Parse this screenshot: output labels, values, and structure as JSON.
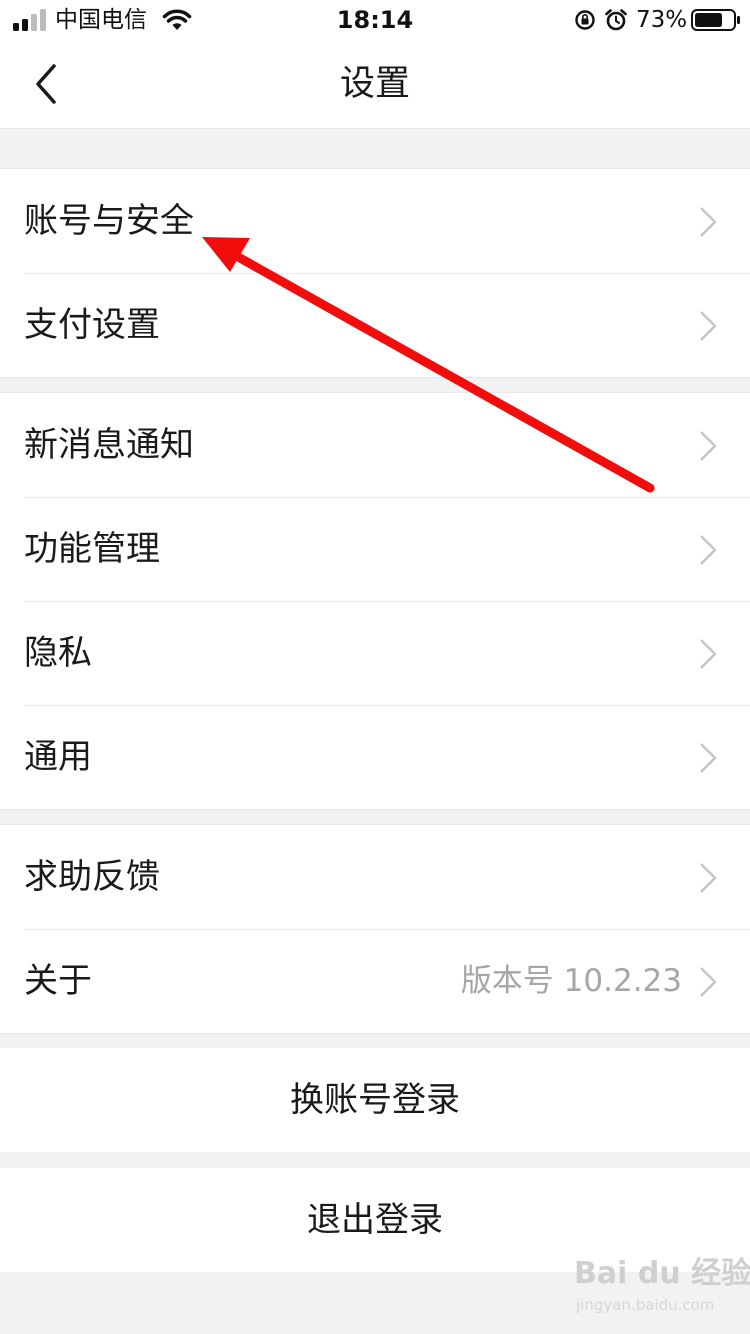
{
  "status_bar": {
    "carrier": "中国电信",
    "time": "18:14",
    "battery_percent": "73%",
    "battery_level": 0.73,
    "icons": [
      "signal-icon",
      "wifi-icon",
      "rotation-lock-icon",
      "alarm-icon",
      "battery-icon"
    ]
  },
  "nav": {
    "title": "设置",
    "back_icon": "chevron-left-icon"
  },
  "groups": [
    {
      "items": [
        {
          "label": "账号与安全"
        },
        {
          "label": "支付设置"
        }
      ]
    },
    {
      "items": [
        {
          "label": "新消息通知"
        },
        {
          "label": "功能管理"
        },
        {
          "label": "隐私"
        },
        {
          "label": "通用"
        }
      ]
    },
    {
      "items": [
        {
          "label": "求助反馈"
        },
        {
          "label": "关于",
          "value": "版本号 10.2.23"
        }
      ]
    }
  ],
  "actions": {
    "switch_account": "换账号登录",
    "logout": "退出登录"
  },
  "annotation": {
    "arrow_color": "#f20d0d"
  },
  "watermark": {
    "line1": "Bai du 经验",
    "line2": "jingyan.baidu.com"
  }
}
